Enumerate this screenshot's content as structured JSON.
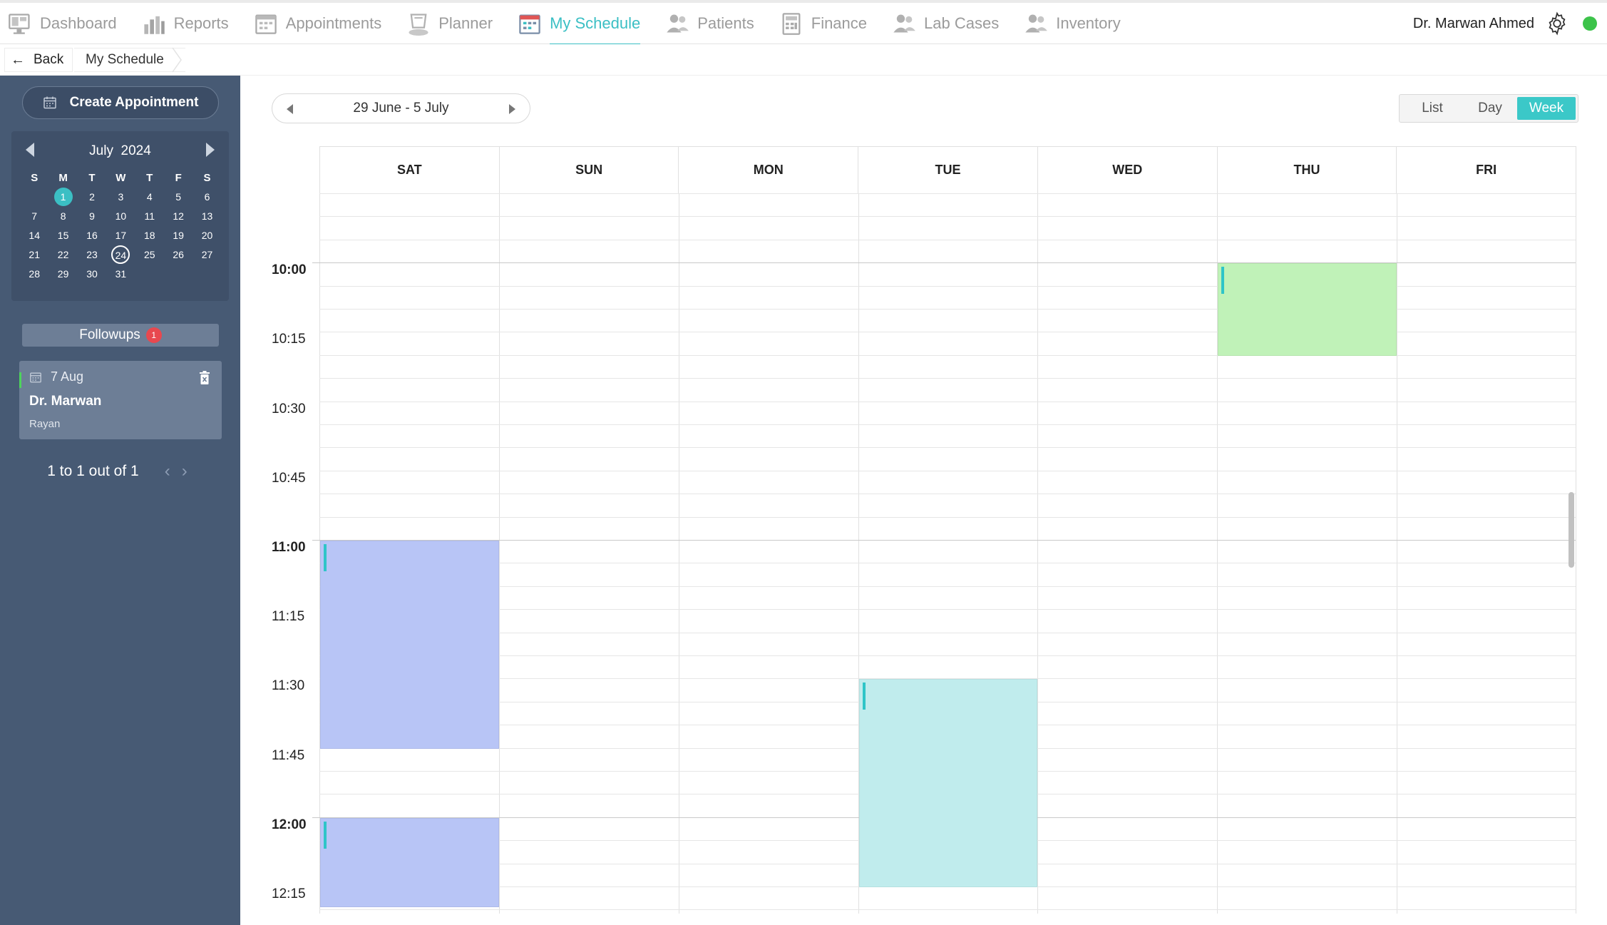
{
  "nav": {
    "items": [
      {
        "label": "Dashboard",
        "icon": "dashboard-icon",
        "active": false
      },
      {
        "label": "Reports",
        "icon": "reports-icon",
        "active": false
      },
      {
        "label": "Appointments",
        "icon": "appointments-icon",
        "active": false
      },
      {
        "label": "Planner",
        "icon": "planner-icon",
        "active": false
      },
      {
        "label": "My Schedule",
        "icon": "schedule-icon",
        "active": true
      },
      {
        "label": "Patients",
        "icon": "patients-icon",
        "active": false
      },
      {
        "label": "Finance",
        "icon": "finance-icon",
        "active": false
      },
      {
        "label": "Lab Cases",
        "icon": "lab-cases-icon",
        "active": false
      },
      {
        "label": "Inventory",
        "icon": "inventory-icon",
        "active": false
      }
    ],
    "user_name": "Dr. Marwan Ahmed",
    "status_color": "#3cc34a",
    "accent_color": "#3bbfc4"
  },
  "breadcrumb": {
    "back_label": "Back",
    "current": "My Schedule"
  },
  "sidebar": {
    "create_label": "Create Appointment",
    "calendar": {
      "month_label": "July",
      "year_label": "2024",
      "weekdays": [
        "S",
        "M",
        "T",
        "W",
        "T",
        "F",
        "S"
      ],
      "weeks": [
        [
          "",
          "1",
          "2",
          "3",
          "4",
          "5",
          "6"
        ],
        [
          "7",
          "8",
          "9",
          "10",
          "11",
          "12",
          "13"
        ],
        [
          "14",
          "15",
          "16",
          "17",
          "18",
          "19",
          "20"
        ],
        [
          "21",
          "22",
          "23",
          "24",
          "25",
          "26",
          "27"
        ],
        [
          "28",
          "29",
          "30",
          "31",
          "",
          "",
          ""
        ]
      ],
      "today": "1",
      "selected": "24"
    },
    "followups_label": "Followups",
    "followups_count": "1",
    "followup": {
      "date": "7 Aug",
      "doctor": "Dr. Marwan",
      "patient": "Rayan"
    },
    "pager_text": "1 to 1 out of 1"
  },
  "schedule": {
    "range_label": "29 June - 5 July",
    "views": [
      "List",
      "Day",
      "Week"
    ],
    "active_view": "Week",
    "days": [
      "SAT",
      "SUN",
      "MON",
      "TUE",
      "WED",
      "THU",
      "FRI"
    ],
    "time_labels": [
      {
        "label": "10:00",
        "hour": true
      },
      {
        "label": "10:15",
        "hour": false
      },
      {
        "label": "10:30",
        "hour": false
      },
      {
        "label": "10:45",
        "hour": false
      },
      {
        "label": "11:00",
        "hour": true
      },
      {
        "label": "11:15",
        "hour": false
      },
      {
        "label": "11:30",
        "hour": false
      },
      {
        "label": "11:45",
        "hour": false
      },
      {
        "label": "12:00",
        "hour": true
      },
      {
        "label": "12:15",
        "hour": false
      }
    ],
    "events": [
      {
        "day": "THU",
        "start": "10:00",
        "end": "10:20",
        "color": "#c0f2b8"
      },
      {
        "day": "SAT",
        "start": "11:00",
        "end": "11:45",
        "color": "#b8c5f6"
      },
      {
        "day": "TUE",
        "start": "11:30",
        "end": "12:15",
        "color": "#c0eced"
      },
      {
        "day": "SAT",
        "start": "12:00",
        "end": "12:30",
        "color": "#b8c5f6"
      }
    ]
  }
}
